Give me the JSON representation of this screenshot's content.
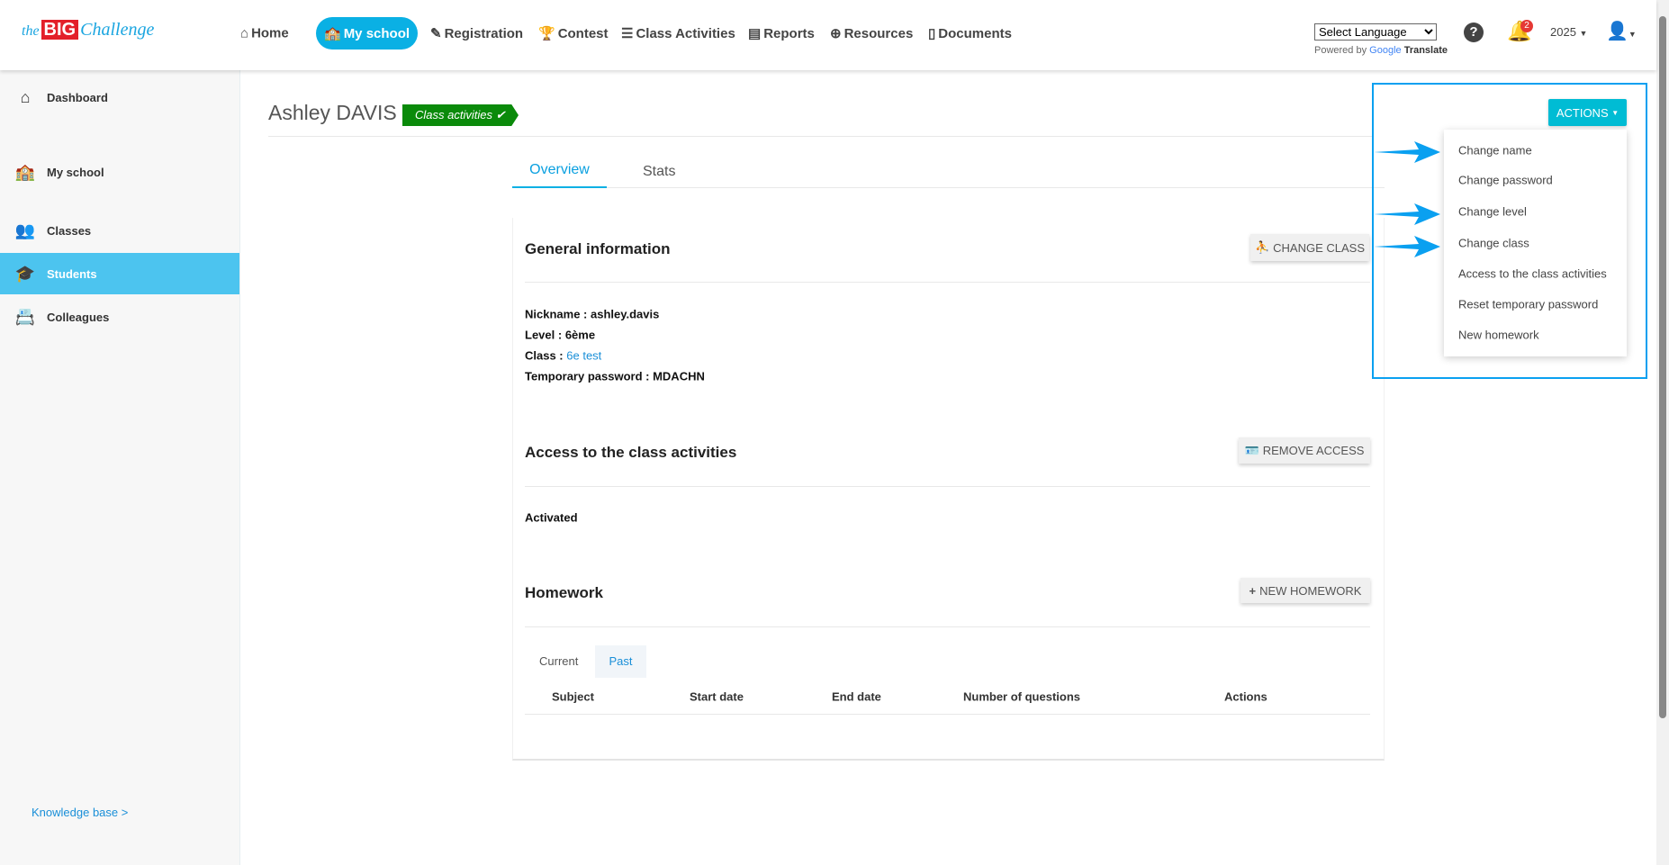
{
  "header": {
    "logo": "the BIG Challenge",
    "nav": [
      {
        "label": "Home",
        "icon": "home-icon"
      },
      {
        "label": "My school",
        "icon": "school-icon",
        "active": true
      },
      {
        "label": "Registration",
        "icon": "edit-icon"
      },
      {
        "label": "Contest",
        "icon": "trophy-icon"
      },
      {
        "label": "Class Activities",
        "icon": "list-icon"
      },
      {
        "label": "Reports",
        "icon": "file-icon"
      },
      {
        "label": "Resources",
        "icon": "globe-icon"
      },
      {
        "label": "Documents",
        "icon": "pdf-icon"
      }
    ],
    "language_select": "Select Language",
    "powered_by": "Powered by",
    "google": "Google",
    "translate": "Translate",
    "notification_count": "2",
    "year": "2025"
  },
  "sidebar": {
    "items": [
      {
        "label": "Dashboard"
      },
      {
        "label": "My school"
      },
      {
        "label": "Classes"
      },
      {
        "label": "Students",
        "active": true
      },
      {
        "label": "Colleagues"
      }
    ],
    "knowledge_base": "Knowledge base >"
  },
  "page": {
    "title": "Ashley DAVIS",
    "badge": "Class activities",
    "tabs": [
      "Overview",
      "Stats"
    ],
    "general": {
      "title": "General information",
      "button": "CHANGE CLASS",
      "nickname_label": "Nickname :",
      "nickname": "ashley.davis",
      "level_label": "Level :",
      "level": "6ème",
      "class_label": "Class :",
      "class": "6e test",
      "password_label": "Temporary password :",
      "password": "MDACHN"
    },
    "access": {
      "title": "Access to the class activities",
      "button": "REMOVE ACCESS",
      "status": "Activated"
    },
    "homework": {
      "title": "Homework",
      "button": "NEW HOMEWORK",
      "tabs": [
        "Current",
        "Past"
      ],
      "columns": [
        "Subject",
        "Start date",
        "End date",
        "Number of questions",
        "Actions"
      ]
    }
  },
  "actions": {
    "button": "ACTIONS",
    "items": [
      "Change name",
      "Change password",
      "Change level",
      "Change class",
      "Access to the class activities",
      "Reset temporary password",
      "New homework"
    ]
  },
  "colors": {
    "accent": "#0ab0e4",
    "badge": "#0a8a0a",
    "annotation": "#0aa0f0"
  }
}
